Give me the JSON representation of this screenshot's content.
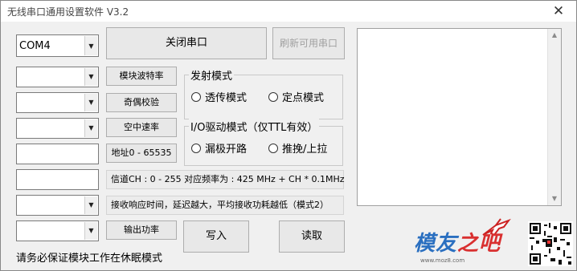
{
  "window": {
    "title": "无线串口通用设置软件 V3.2",
    "close_symbol": "✕"
  },
  "port": {
    "value": "COM4",
    "close_label": "关闭串口",
    "refresh_label": "刷新可用串口"
  },
  "rows": [
    {
      "value": "",
      "button": "模块波特率"
    },
    {
      "value": "",
      "button": "奇偶校验"
    },
    {
      "value": "",
      "button": "空中速率"
    }
  ],
  "address": {
    "value": "",
    "button": "地址0 - 65535"
  },
  "channel": {
    "value": "",
    "label": "信道CH : 0 - 255  对应频率为 : 425 MHz + CH * 0.1MHz"
  },
  "wake": {
    "value": "",
    "label": "接收响应时间，延迟越大，平均接收功耗越低（模式2）"
  },
  "power": {
    "value": "",
    "button": "输出功率"
  },
  "tx_mode": {
    "title": "发射模式",
    "options": [
      "透传模式",
      "定点模式"
    ]
  },
  "io_mode": {
    "title": "I/O驱动模式（仅TTL有效）",
    "options": [
      "漏极开路",
      "推挽/上拉"
    ]
  },
  "actions": {
    "write": "写入",
    "read": "读取"
  },
  "status": "请务必保证模块工作在休眠模式",
  "watermark": {
    "text_a": "模友",
    "text_b": "之吧",
    "url": "www.moz8.com"
  },
  "icons": {
    "dropdown": "▼",
    "scroll_up": "▲",
    "scroll_down": "▼"
  }
}
